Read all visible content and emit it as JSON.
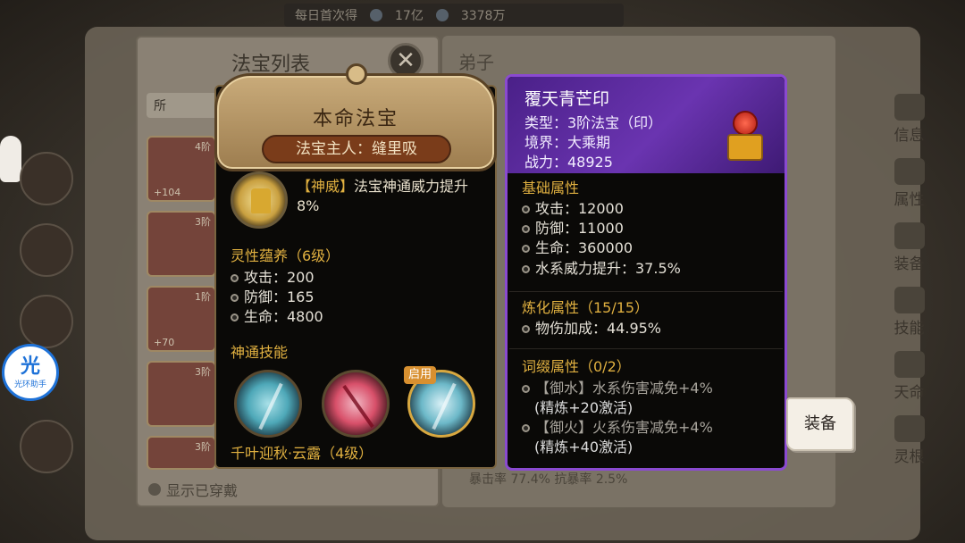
{
  "top_banner": {
    "label": "每日首次得",
    "amount_1": "17亿",
    "amount_2": "3378万"
  },
  "list_panel": {
    "title": "法宝列表",
    "tab_label": "所",
    "show_worn_label": "显示已穿戴",
    "slots": [
      {
        "tier": "4阶",
        "plus": "+104"
      },
      {
        "tier": "3阶",
        "plus": ""
      },
      {
        "tier": "1阶",
        "plus": "+70"
      },
      {
        "tier": "3阶",
        "plus": ""
      },
      {
        "tier": "3阶",
        "plus": ""
      }
    ]
  },
  "bg_right": {
    "label": "弟子",
    "stats": "暴击率 77.4%  抗暴率 2.5%"
  },
  "helper": {
    "big": "光",
    "small": "光环助手"
  },
  "right_nav": [
    {
      "label": "信息",
      "icon": "info-icon"
    },
    {
      "label": "属性",
      "icon": "attribute-icon"
    },
    {
      "label": "装备",
      "icon": "equipment-icon"
    },
    {
      "label": "技能",
      "icon": "skill-icon"
    },
    {
      "label": "天命",
      "icon": "destiny-icon"
    },
    {
      "label": "灵根",
      "icon": "spirit-root-icon"
    }
  ],
  "life_treasure": {
    "title": "本命法宝",
    "owner": "法宝主人：缝里吸",
    "divine_tag": "【神威】",
    "divine_text": "法宝神通威力提升8%",
    "nurture_title": "灵性蕴养（6级）",
    "nurture_stats": [
      "攻击：200",
      "防御：165",
      "生命：4800"
    ],
    "skills_title": "神通技能",
    "active_tag": "启用",
    "skill_name": "千叶迎秋·云露（4级）"
  },
  "treasure": {
    "name": "覆天青芒印",
    "type": "类型：3阶法宝（印）",
    "realm": "境界：大乘期",
    "power": "战力：48925",
    "base_title": "基础属性",
    "base_stats": [
      "攻击：12000",
      "防御：11000",
      "生命：360000",
      "水系威力提升：37.5%"
    ],
    "refine_title": "炼化属性（15/15）",
    "refine_stats": [
      "物伤加成：44.95%"
    ],
    "affix_title": "词缀属性（0/2）",
    "affixes": [
      {
        "line1": "【御水】水系伤害减免+4%",
        "line2": "(精炼+20激活)"
      },
      {
        "line1": "【御火】火系伤害减免+4%",
        "line2": "(精炼+40激活)"
      }
    ],
    "equip_label": "装备"
  },
  "colors": {
    "gold_text": "#e0b040",
    "purple_border": "#8a4ad0",
    "purple_head": "#6a34b0"
  }
}
